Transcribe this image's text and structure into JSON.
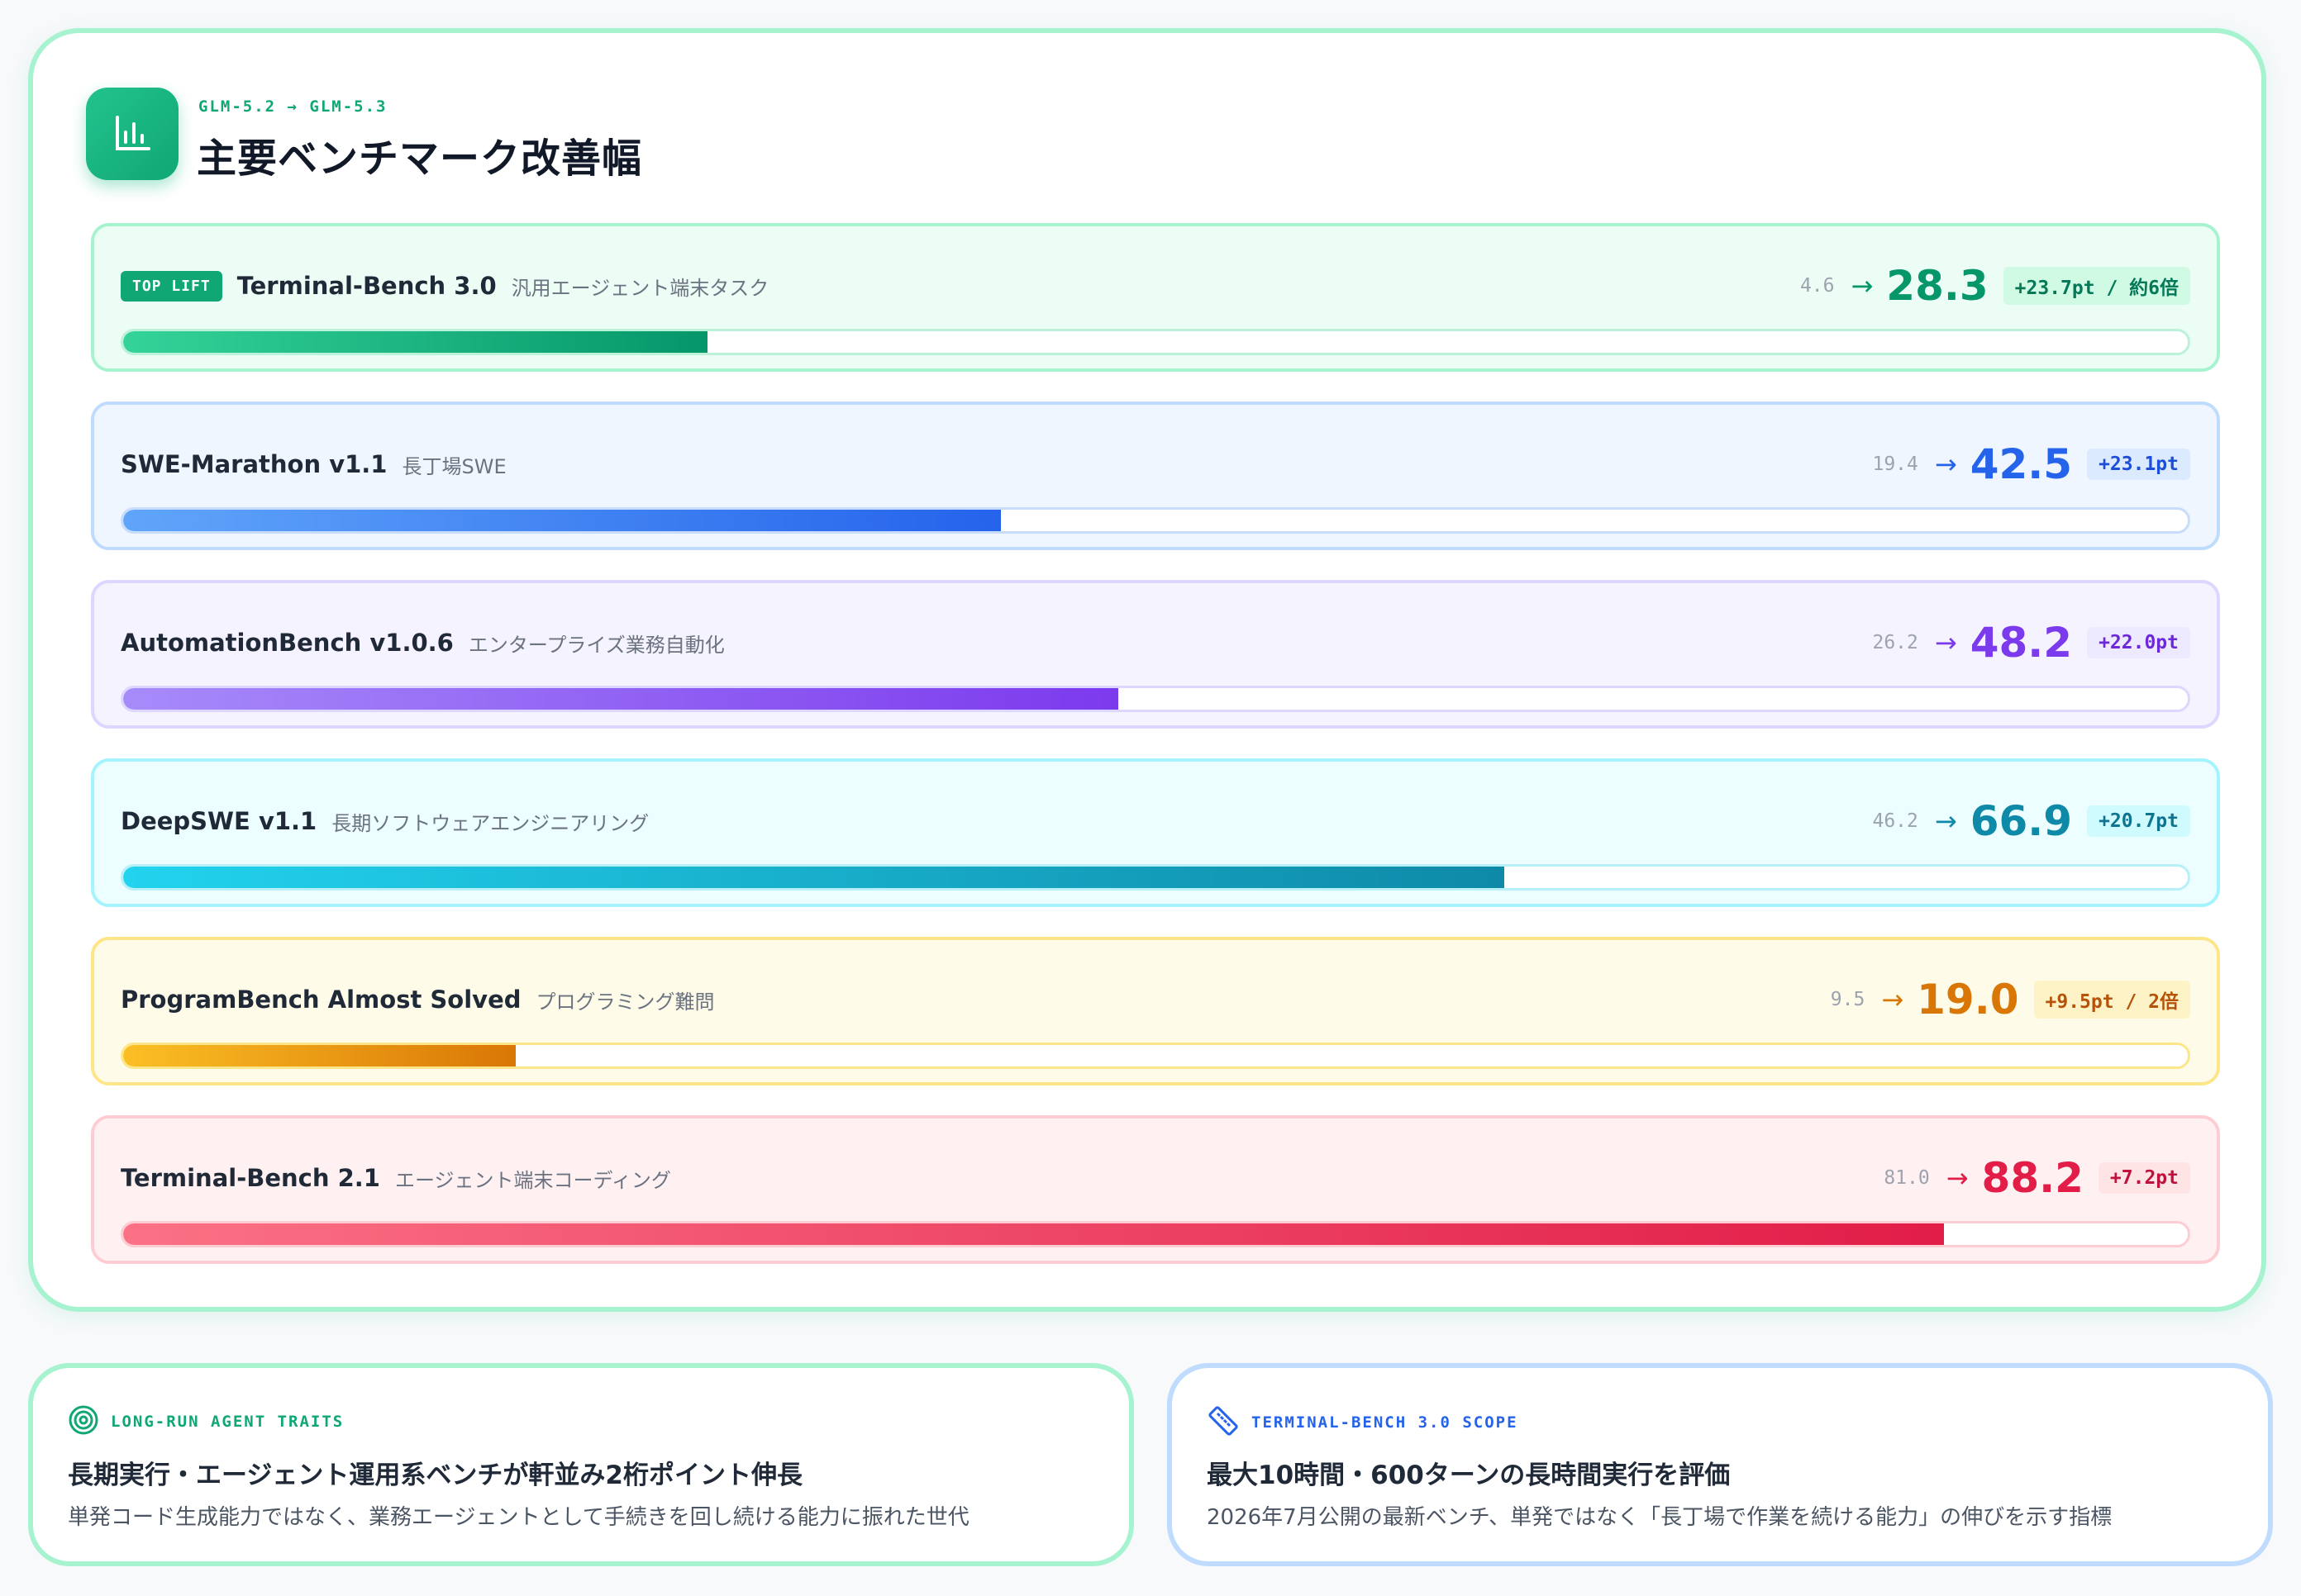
{
  "header": {
    "subtitle": "GLM-5.2 → GLM-5.3",
    "title": "主要ベンチマーク改善幅",
    "icon": "bar-chart-icon"
  },
  "benchmarks": [
    {
      "tag": "TOP LIFT",
      "name": "Terminal-Bench 3.0",
      "desc": "汎用エージェント端末タスク",
      "before": "4.6",
      "after": "28.3",
      "delta": "+23.7pt / 約6倍",
      "progress_pct": 28.3,
      "color": "#059669"
    },
    {
      "name": "SWE-Marathon v1.1",
      "desc": "長丁場SWE",
      "before": "19.4",
      "after": "42.5",
      "delta": "+23.1pt",
      "progress_pct": 42.5,
      "color": "#2563eb"
    },
    {
      "name": "AutomationBench v1.0.6",
      "desc": "エンタープライズ業務自動化",
      "before": "26.2",
      "after": "48.2",
      "delta": "+22.0pt",
      "progress_pct": 48.2,
      "color": "#7c3aed"
    },
    {
      "name": "DeepSWE v1.1",
      "desc": "長期ソフトウェアエンジニアリング",
      "before": "46.2",
      "after": "66.9",
      "delta": "+20.7pt",
      "progress_pct": 66.9,
      "color": "#0e8aa8"
    },
    {
      "name": "ProgramBench Almost Solved",
      "desc": "プログラミング難問",
      "before": "9.5",
      "after": "19.0",
      "delta": "+9.5pt / 2倍",
      "progress_pct": 19.0,
      "color": "#d97706"
    },
    {
      "name": "Terminal-Bench 2.1",
      "desc": "エージェント端末コーディング",
      "before": "81.0",
      "after": "88.2",
      "delta": "+7.2pt",
      "progress_pct": 88.2,
      "color": "#e11d48"
    }
  ],
  "arrow_glyph": "→",
  "notes": [
    {
      "icon": "target-icon",
      "label": "LONG-RUN AGENT TRAITS",
      "title": "長期実行・エージェント運用系ベンチが軒並み2桁ポイント伸長",
      "body": "単発コード生成能力ではなく、業務エージェントとして手続きを回し続ける能力に振れた世代"
    },
    {
      "icon": "ruler-icon",
      "label": "TERMINAL-BENCH 3.0 SCOPE",
      "title": "最大10時間・600ターンの長時間実行を評価",
      "body": "2026年7月公開の最新ベンチ、単発ではなく「長丁場で作業を続ける能力」の伸びを示す指標"
    }
  ]
}
